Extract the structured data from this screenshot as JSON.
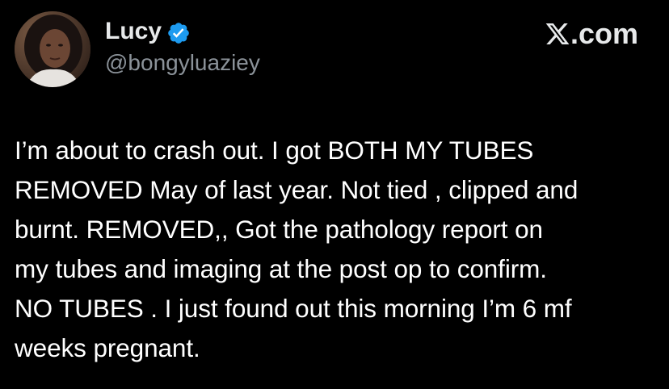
{
  "tweet": {
    "author": {
      "name": "Lucy",
      "handle": "@bongyluaziey",
      "verified": true,
      "avatar": "avatar-photo"
    },
    "brand": {
      "icon": "x-logo-icon",
      "label": ".com"
    },
    "text_lines": [
      "I’m about to crash out. I got BOTH MY TUBES",
      "REMOVED May of last year. Not tied , clipped and",
      "burnt. REMOVED,, Got the pathology report on",
      "my tubes and imaging at the post op to confirm.",
      "NO TUBES . I just found out this morning I’m 6 mf",
      "weeks pregnant."
    ]
  },
  "colors": {
    "background": "#000000",
    "text": "#ffffff",
    "handle": "#8b9299",
    "verified": "#1d9bf0"
  }
}
